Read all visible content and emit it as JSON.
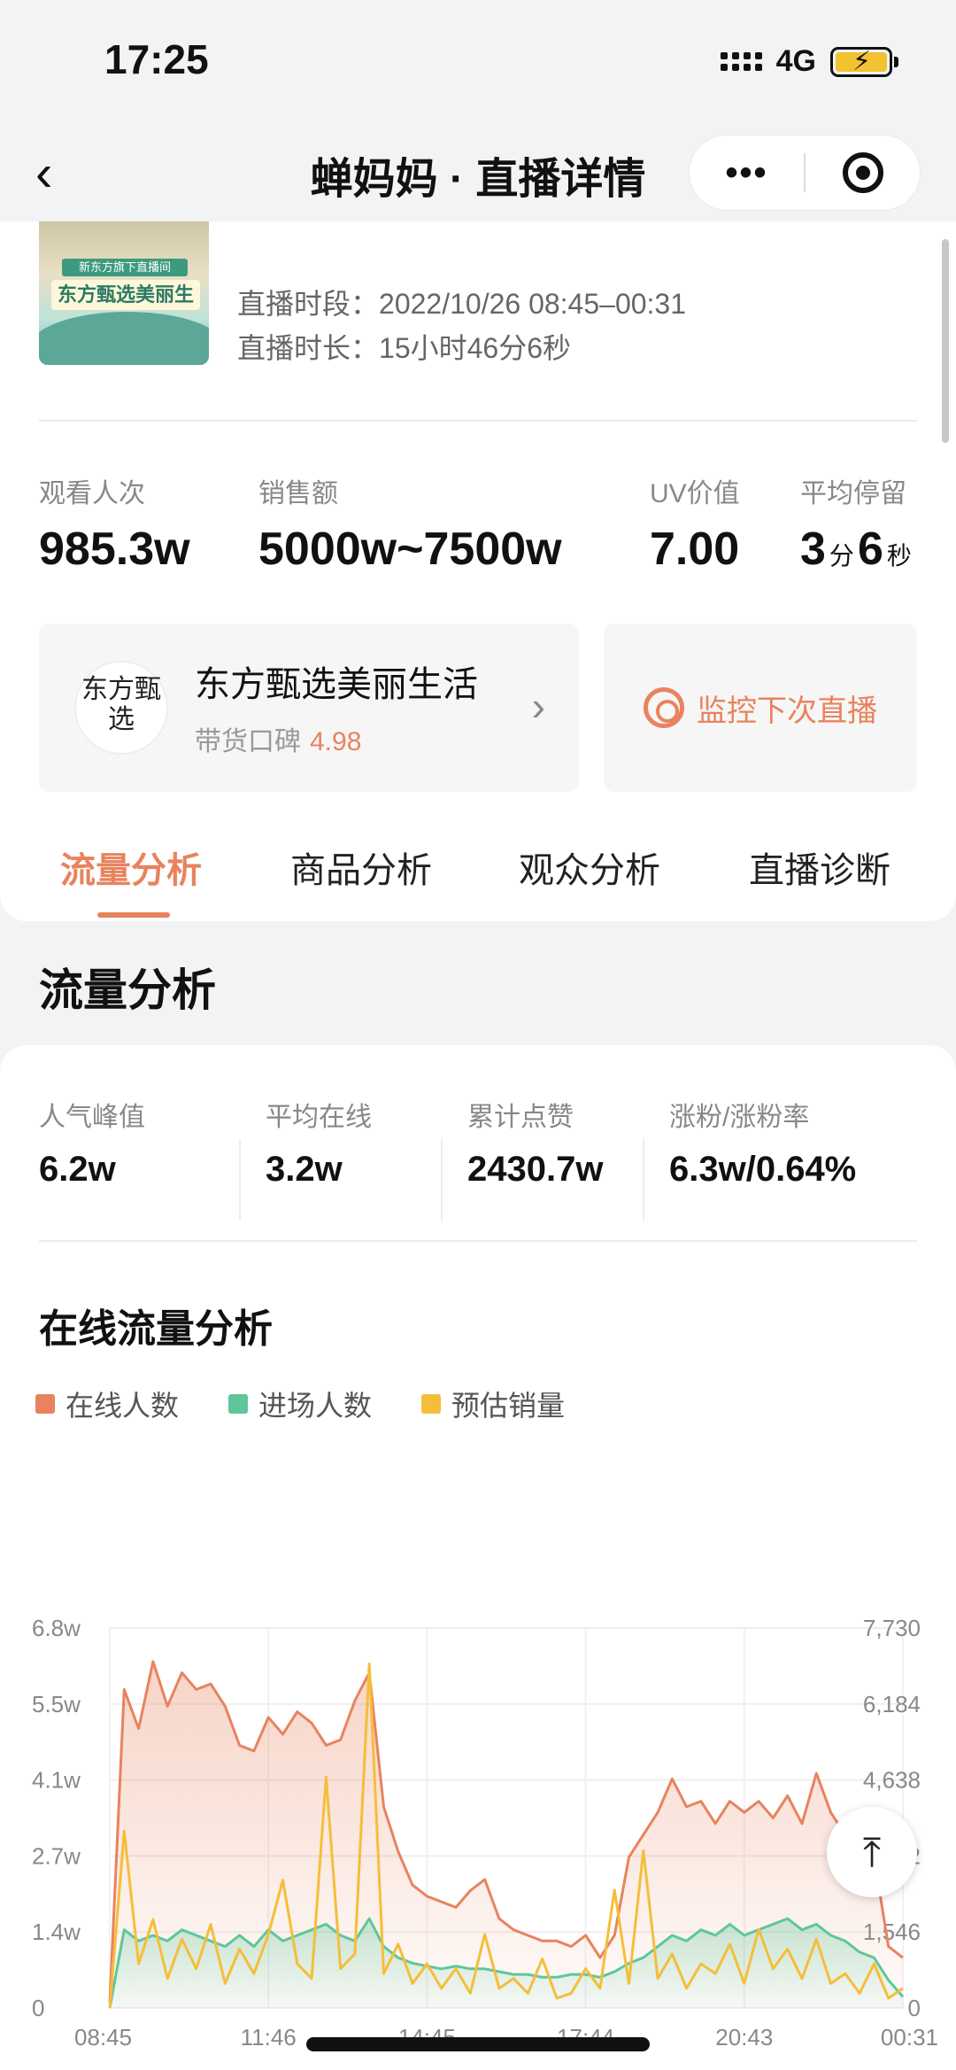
{
  "status": {
    "time": "17:25",
    "network": "4G"
  },
  "nav": {
    "title": "蝉妈妈 · 直播详情",
    "back": "‹",
    "more": "•••"
  },
  "live": {
    "cover_sub": "新东方旗下直播间",
    "cover_title": "东方甄选美丽生活",
    "period_label": "直播时段：",
    "period_value": "2022/10/26 08:45–00:31",
    "duration_label": "直播时长：",
    "duration_value": "15小时46分6秒"
  },
  "stats": [
    {
      "label": "观看人次",
      "value": "985.3w"
    },
    {
      "label": "销售额",
      "value": "5000w~7500w"
    },
    {
      "label": "UV价值",
      "value": "7.00"
    },
    {
      "label": "平均停留",
      "minutes": "3",
      "min_unit": "分",
      "seconds": "6",
      "sec_unit": "秒"
    }
  ],
  "shop": {
    "logo_text": "东方甄选",
    "name": "东方甄选美丽生活",
    "rating_label": "带货口碑",
    "rating_value": "4.98",
    "arrow": "›"
  },
  "monitor": {
    "label": "监控下次直播"
  },
  "tabs": [
    {
      "label": "流量分析",
      "active": true
    },
    {
      "label": "商品分析",
      "active": false
    },
    {
      "label": "观众分析",
      "active": false
    },
    {
      "label": "直播诊断",
      "active": false
    }
  ],
  "section": {
    "title": "流量分析"
  },
  "kpis": [
    {
      "label": "人气峰值",
      "value": "6.2w"
    },
    {
      "label": "平均在线",
      "value": "3.2w"
    },
    {
      "label": "累计点赞",
      "value": "2430.7w"
    },
    {
      "label": "涨粉/涨粉率",
      "value": "6.3w/0.64%"
    }
  ],
  "chart_title": "在线流量分析",
  "colors": {
    "online": "#e8835e",
    "entry": "#5ec79a",
    "sales": "#f5be3a",
    "accent": "#e8835e"
  },
  "to_top_icon": "arrow-up-to-line-icon",
  "chart_data": {
    "type": "line",
    "legend": [
      "在线人数",
      "进场人数",
      "预估销量"
    ],
    "x_ticks": [
      "08:45",
      "11:46",
      "14:45",
      "17:44",
      "20:43",
      "00:31"
    ],
    "y_left_ticks": [
      "0",
      "1.4w",
      "2.7w",
      "4.1w",
      "5.5w",
      "6.8w"
    ],
    "y_right_ticks": [
      "0",
      "1,546",
      "3,092",
      "4,638",
      "6,184",
      "7,730"
    ],
    "ylim_left": [
      0,
      68000
    ],
    "ylim_right": [
      0,
      7730
    ],
    "series": [
      {
        "name": "在线人数",
        "values": [
          1000,
          57000,
          50000,
          62000,
          54000,
          60000,
          57000,
          58000,
          54000,
          47000,
          46000,
          52000,
          49000,
          53000,
          51000,
          47000,
          48000,
          55000,
          60000,
          36000,
          28000,
          22000,
          20000,
          19000,
          18000,
          21000,
          23000,
          16000,
          14000,
          13000,
          12000,
          12000,
          11000,
          13000,
          9000,
          13000,
          27000,
          31000,
          35000,
          41000,
          36000,
          37000,
          33000,
          37000,
          35000,
          37000,
          34000,
          38000,
          33000,
          42000,
          35000,
          31000,
          33000,
          27000,
          11000,
          9000
        ]
      },
      {
        "name": "进场人数",
        "values": [
          0,
          14000,
          12000,
          13000,
          12000,
          14000,
          13000,
          12000,
          11000,
          13000,
          11000,
          14000,
          12000,
          13000,
          14000,
          15000,
          13000,
          12000,
          16000,
          11000,
          9000,
          8000,
          7500,
          7000,
          7500,
          7000,
          7000,
          6500,
          6000,
          6000,
          5500,
          5500,
          6000,
          6000,
          5500,
          6500,
          8000,
          9000,
          11000,
          13000,
          12000,
          14000,
          13000,
          15000,
          13000,
          14000,
          15000,
          16000,
          14000,
          15000,
          13000,
          12000,
          10000,
          9000,
          5000,
          2000
        ]
      },
      {
        "name": "预估销量",
        "values": [
          0,
          3600,
          900,
          1800,
          600,
          1400,
          800,
          1700,
          500,
          1200,
          700,
          1500,
          2600,
          900,
          600,
          4700,
          800,
          1100,
          7000,
          700,
          1300,
          500,
          900,
          400,
          800,
          300,
          1500,
          400,
          600,
          300,
          1000,
          200,
          300,
          800,
          400,
          2400,
          500,
          3200,
          600,
          1100,
          400,
          900,
          700,
          1300,
          500,
          1600,
          800,
          1200,
          600,
          1400,
          500,
          700,
          300,
          900,
          200,
          400
        ]
      }
    ]
  }
}
